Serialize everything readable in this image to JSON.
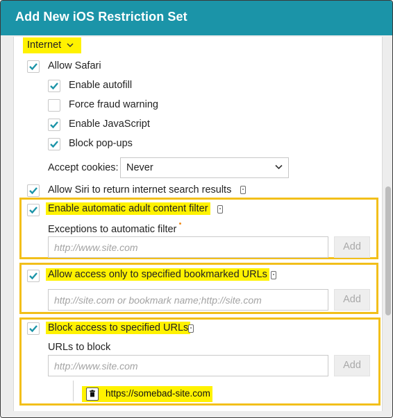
{
  "dialog": {
    "title": "Add New iOS Restriction Set"
  },
  "section": {
    "label": "Internet"
  },
  "safari": {
    "allow_label": "Allow Safari",
    "allow_checked": true,
    "options": [
      {
        "label": "Enable autofill",
        "checked": true
      },
      {
        "label": "Force fraud warning",
        "checked": false
      },
      {
        "label": "Enable JavaScript",
        "checked": true
      },
      {
        "label": "Block pop-ups",
        "checked": true
      }
    ],
    "cookies_label": "Accept cookies:",
    "cookies_value": "Never"
  },
  "siri": {
    "label": "Allow Siri to return internet search results",
    "checked": true
  },
  "adult_filter": {
    "label": "Enable automatic adult content filter",
    "checked": true,
    "exceptions_label": "Exceptions to automatic filter",
    "placeholder": "http://www.site.com",
    "add_label": "Add"
  },
  "bookmarked": {
    "label": "Allow access only to specified bookmarked URLs",
    "checked": true,
    "placeholder": "http://site.com or bookmark name;http://site.com",
    "add_label": "Add"
  },
  "block_urls": {
    "label": "Block access to specified URLs",
    "checked": true,
    "urls_label": "URLs to block",
    "placeholder": "http://www.site.com",
    "add_label": "Add",
    "entries": [
      "https://somebad-site.com"
    ]
  },
  "colors": {
    "header": "#1b94a8",
    "check": "#1b94a8",
    "highlight": "#fff200",
    "box_border": "#f2bf1a"
  }
}
